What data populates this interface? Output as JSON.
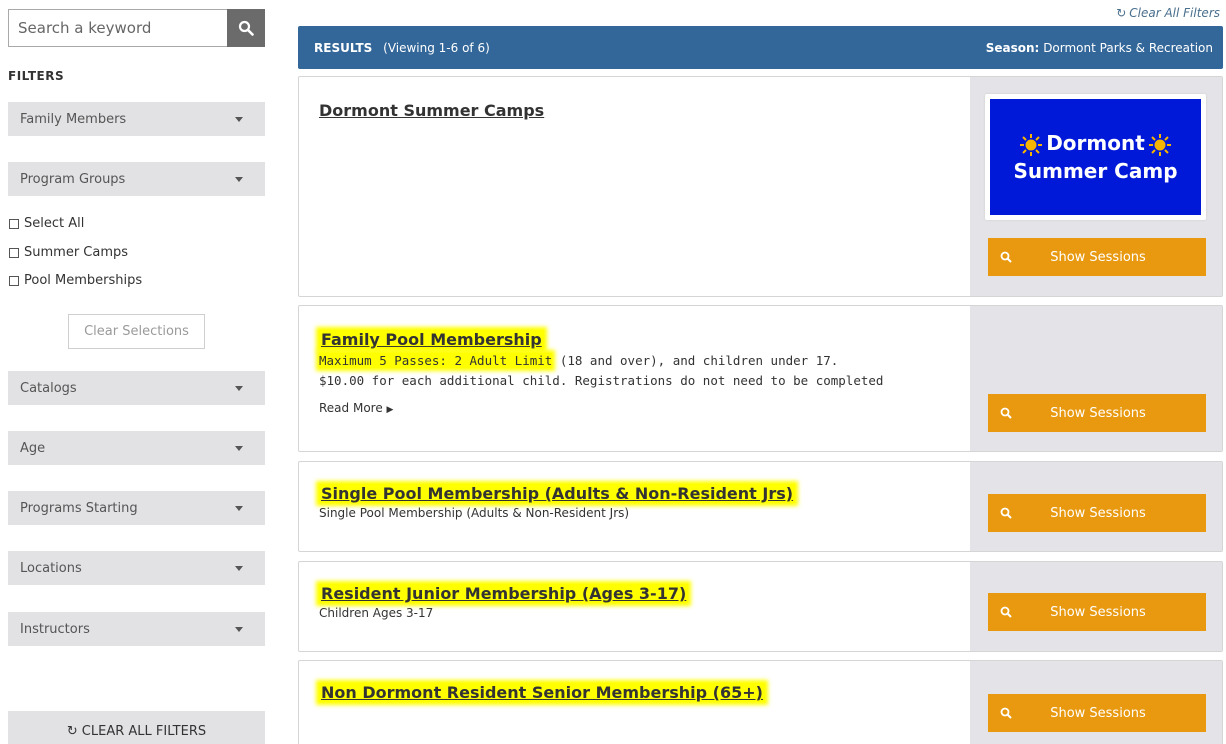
{
  "search": {
    "placeholder": "Search a keyword"
  },
  "filters": {
    "heading": "FILTERS",
    "family_members": "Family Members",
    "program_groups": "Program Groups",
    "checkboxes": [
      "Select All",
      "Summer Camps",
      "Pool Memberships"
    ],
    "clear_selections": "Clear Selections",
    "catalogs": "Catalogs",
    "age": "Age",
    "programs_starting": "Programs Starting",
    "locations": "Locations",
    "instructors": "Instructors",
    "clear_all_filters": "CLEAR ALL FILTERS"
  },
  "top": {
    "clear_all_filters": "Clear All Filters"
  },
  "results_bar": {
    "label": "RESULTS",
    "viewing": "(Viewing 1-6 of 6)",
    "season_label": "Season:",
    "season_value": "Dormont Parks & Recreation"
  },
  "programs": [
    {
      "title": "Dormont Summer Camps",
      "logo_line1": "Dormont",
      "logo_line2": "Summer Camp"
    },
    {
      "title": "Family Pool Membership",
      "desc_line1_hl": "Maximum 5 Passes: 2 Adult Limit",
      "desc_line1_rest": " (18 and over), and children under 17.",
      "desc_line2": "$10.00 for each additional child.  Registrations do not need to be completed",
      "read_more": "Read More"
    },
    {
      "title": "Single Pool Membership (Adults & Non-Resident Jrs)",
      "desc": "Single Pool Membership (Adults & Non-Resident Jrs)"
    },
    {
      "title": "Resident Junior Membership (Ages 3-17)",
      "desc": "Children Ages 3-17"
    },
    {
      "title": "Non Dormont Resident Senior Membership (65+)"
    }
  ],
  "show_sessions": "Show Sessions",
  "colors": {
    "results_bar": "#336699",
    "show_button": "#e8990f",
    "highlight": "#ffff00",
    "sidebar_dropdown": "#e2e2e5",
    "card_right_panel": "#e4e4e8",
    "logo_bg": "#0018d8"
  },
  "icons": {
    "search": "search-icon",
    "caret": "caret-down-icon",
    "refresh": "refresh-icon",
    "magnifier": "magnifier-icon",
    "sun": "sun-icon",
    "read_more_arrow": "triangle-right-icon"
  }
}
